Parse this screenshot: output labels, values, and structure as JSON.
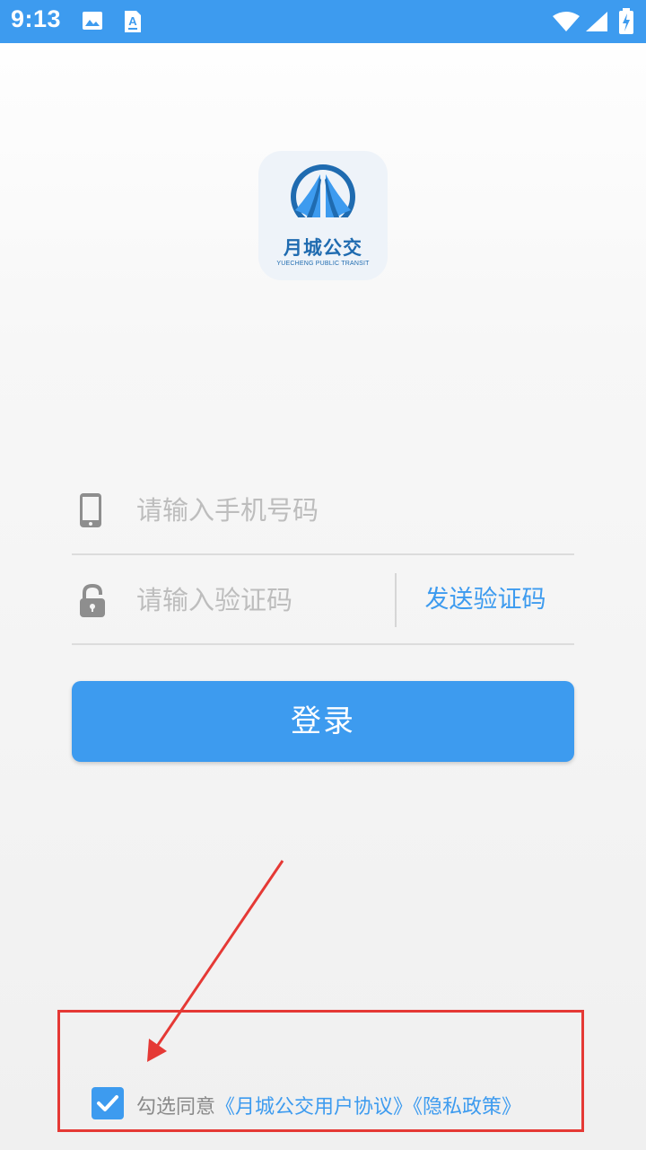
{
  "status_bar": {
    "time": "9:13",
    "icons": [
      "image-icon",
      "text-a-icon",
      "wifi-icon",
      "signal-icon",
      "battery-charging-icon"
    ]
  },
  "logo": {
    "name": "月城公交",
    "subtitle": "YUECHENG PUBLIC TRANSIT"
  },
  "form": {
    "phone_placeholder": "请输入手机号码",
    "code_placeholder": "请输入验证码",
    "send_code_label": "发送验证码",
    "login_label": "登录"
  },
  "agreement": {
    "checked": true,
    "prefix": "勾选同意",
    "user_agreement": "《月城公交用户协议》",
    "privacy_policy": "《隐私政策》"
  },
  "colors": {
    "accent": "#3d9bef",
    "annotation": "#e53935"
  }
}
